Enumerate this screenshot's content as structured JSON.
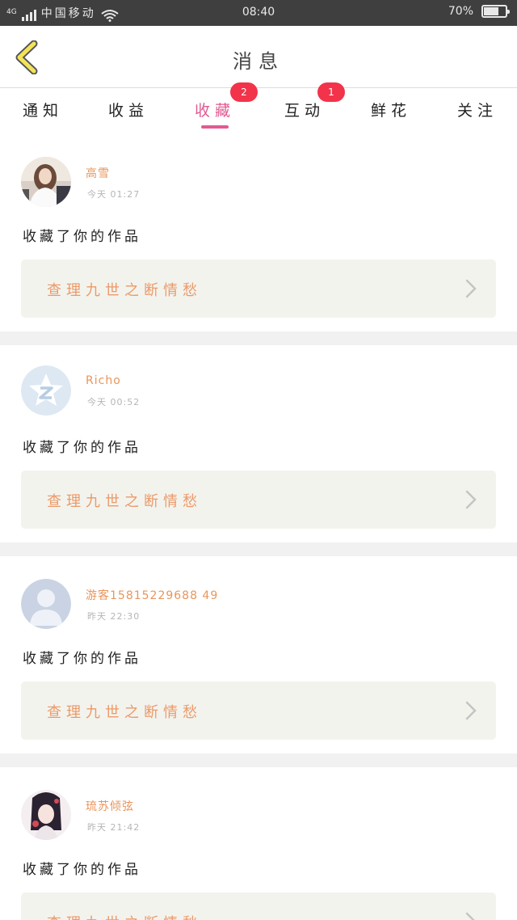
{
  "status_bar": {
    "network": "4G",
    "carrier": "中国移动",
    "time": "08:40",
    "battery": "70%",
    "battery_level": 0.7
  },
  "header": {
    "title": "消息"
  },
  "tabs": [
    {
      "label": "通知"
    },
    {
      "label": "收益"
    },
    {
      "label": "收藏",
      "badge": "2",
      "active": true
    },
    {
      "label": "互动",
      "badge": "1"
    },
    {
      "label": "鲜花"
    },
    {
      "label": "关注"
    }
  ],
  "feed": [
    {
      "username": "高雪",
      "time": "今天 01:27",
      "action": "收藏了你的作品",
      "work_title": "查理九世之断情愁"
    },
    {
      "username": "Richo",
      "time": "今天 00:52",
      "action": "收藏了你的作品",
      "work_title": "查理九世之断情愁"
    },
    {
      "username": "游客15815229688 49",
      "time": "昨天 22:30",
      "action": "收藏了你的作品",
      "work_title": "查理九世之断情愁"
    },
    {
      "username": "琉苏倾弦",
      "time": "昨天 21:42",
      "action": "收藏了你的作品",
      "work_title": "查理九世之断情愁"
    }
  ],
  "colors": {
    "accent": "#e15a91",
    "badge": "#f2334a",
    "username": "#e9955b",
    "work_title": "#eb9a68"
  }
}
